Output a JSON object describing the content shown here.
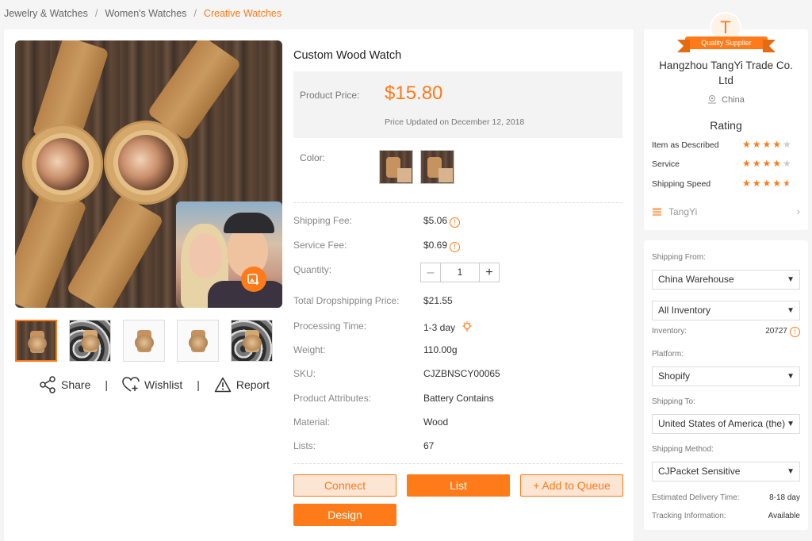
{
  "breadcrumb": {
    "items": [
      "Jewelry & Watches",
      "Women's Watches"
    ],
    "current": "Creative Watches",
    "separator": "/"
  },
  "gallery": {
    "thumb_count": 5
  },
  "actions": {
    "share": "Share",
    "wishlist": "Wishlist",
    "report": "Report"
  },
  "product": {
    "title": "Custom Wood Watch",
    "price_label": "Product Price:",
    "price": "$15.80",
    "price_updated": "Price Updated on December 12, 2018",
    "color_label": "Color:"
  },
  "specs": {
    "shipping_fee_label": "Shipping Fee:",
    "shipping_fee": "$5.06",
    "service_fee_label": "Service Fee:",
    "service_fee": "$0.69",
    "quantity_label": "Quantity:",
    "quantity": "1",
    "total_label": "Total Dropshipping Price:",
    "total": "$21.55",
    "processing_label": "Processing Time:",
    "processing": "1-3 day",
    "weight_label": "Weight:",
    "weight": "110.00g",
    "sku_label": "SKU:",
    "sku": "CJZBNSCY00065",
    "attributes_label": "Product Attributes:",
    "attributes": "Battery Contains",
    "material_label": "Material:",
    "material": "Wood",
    "lists_label": "Lists:",
    "lists": "67"
  },
  "buttons": {
    "connect": "Connect",
    "list": "List",
    "add_queue": "+ Add to Queue",
    "design": "Design"
  },
  "supplier": {
    "avatar_letter": "T",
    "badge": "Quality Supplier",
    "name": "Hangzhou TangYi Trade Co. Ltd",
    "location": "China",
    "rating_title": "Rating",
    "ratings": [
      {
        "label": "Item as Described",
        "stars": 4
      },
      {
        "label": "Service",
        "stars": 4
      },
      {
        "label": "Shipping Speed",
        "stars": 4.5
      }
    ],
    "store": "TangYi"
  },
  "shipping": {
    "from_label": "Shipping From:",
    "from_value": "China Warehouse",
    "inventory_select": "All Inventory",
    "inventory_label": "Inventory:",
    "inventory_value": "20727",
    "platform_label": "Platform:",
    "platform_value": "Shopify",
    "to_label": "Shipping To:",
    "to_value": "United States of America (the)",
    "method_label": "Shipping Method:",
    "method_value": "CJPacket Sensitive",
    "delivery_label": "Estimated Delivery Time:",
    "delivery_value": "8-18 day",
    "tracking_label": "Tracking Information:",
    "tracking_value": "Available"
  },
  "colors": {
    "accent": "#ff7a18",
    "accent_light": "#fde5d3",
    "background": "#f5f5f5"
  }
}
